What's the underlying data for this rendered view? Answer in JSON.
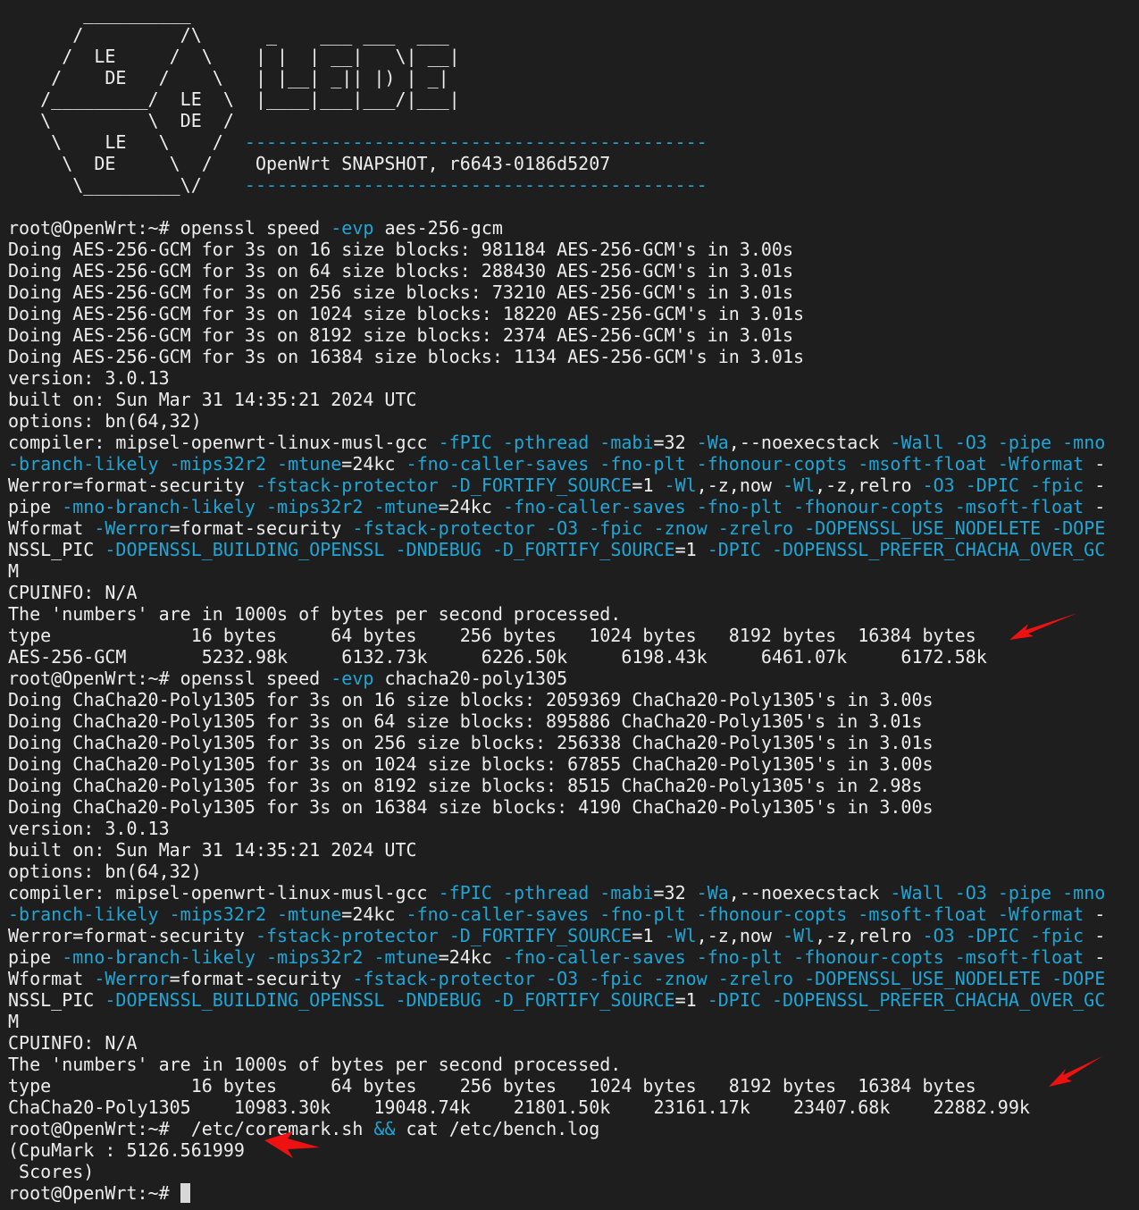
{
  "colors": {
    "background": "#1e1e1e",
    "text": "#ededed",
    "accent": "#1ea6d6",
    "arrow": "#ee1111"
  },
  "banner": [
    [
      [
        "       __________",
        ""
      ]
    ],
    [
      [
        "      /         /\\      _    ___ ___  ___",
        ""
      ]
    ],
    [
      [
        "     /  LE     /  \\    | |  | __|   \\| __|",
        ""
      ]
    ],
    [
      [
        "    /    DE   /    \\   | |__| _|| |) | _|",
        ""
      ]
    ],
    [
      [
        "   /_________/  LE  \\  |____|___|___/|___|",
        ""
      ]
    ],
    [
      [
        "   \\         \\  DE  /",
        ""
      ]
    ],
    [
      [
        "    \\    LE   \\    /  ",
        ""
      ],
      [
        "-------------------------------------------",
        "g"
      ]
    ],
    [
      [
        "     \\  DE     \\  /    OpenWrt SNAPSHOT, r6643-0186d5207",
        ""
      ]
    ],
    [
      [
        "      \\_________\\/    ",
        ""
      ],
      [
        "-------------------------------------------",
        "g"
      ]
    ],
    [
      [
        "",
        ""
      ]
    ]
  ],
  "session": [
    [
      [
        "root@OpenWrt:~# openssl speed ",
        ""
      ],
      [
        "-evp",
        "g"
      ],
      [
        " aes-256-gcm",
        ""
      ]
    ],
    [
      [
        "Doing AES-256-GCM for 3s on 16 size blocks: 981184 AES-256-GCM's in 3.00s",
        ""
      ]
    ],
    [
      [
        "Doing AES-256-GCM for 3s on 64 size blocks: 288430 AES-256-GCM's in 3.01s",
        ""
      ]
    ],
    [
      [
        "Doing AES-256-GCM for 3s on 256 size blocks: 73210 AES-256-GCM's in 3.01s",
        ""
      ]
    ],
    [
      [
        "Doing AES-256-GCM for 3s on 1024 size blocks: 18220 AES-256-GCM's in 3.01s",
        ""
      ]
    ],
    [
      [
        "Doing AES-256-GCM for 3s on 8192 size blocks: 2374 AES-256-GCM's in 3.01s",
        ""
      ]
    ],
    [
      [
        "Doing AES-256-GCM for 3s on 16384 size blocks: 1134 AES-256-GCM's in 3.01s",
        ""
      ]
    ],
    [
      [
        "version: 3.0.13",
        ""
      ]
    ],
    [
      [
        "built on: Sun Mar 31 14:35:21 2024 UTC",
        ""
      ]
    ],
    [
      [
        "options: bn(64,32)",
        ""
      ]
    ],
    [
      [
        "compiler: mipsel-openwrt-linux-musl-gcc ",
        ""
      ],
      [
        "-fPIC",
        "g"
      ],
      [
        " ",
        ""
      ],
      [
        "-pthread",
        "g"
      ],
      [
        " ",
        ""
      ],
      [
        "-mabi",
        "g"
      ],
      [
        "=32 ",
        ""
      ],
      [
        "-Wa",
        "g"
      ],
      [
        ",--noexecstack ",
        ""
      ],
      [
        "-Wall",
        "g"
      ],
      [
        " ",
        ""
      ],
      [
        "-O3",
        "g"
      ],
      [
        " ",
        ""
      ],
      [
        "-pipe",
        "g"
      ],
      [
        " ",
        ""
      ],
      [
        "-mno",
        "g"
      ]
    ],
    [
      [
        "-branch-likely",
        "g"
      ],
      [
        " ",
        ""
      ],
      [
        "-mips32r2",
        "g"
      ],
      [
        " ",
        ""
      ],
      [
        "-mtune",
        "g"
      ],
      [
        "=24kc ",
        ""
      ],
      [
        "-fno-caller-saves",
        "g"
      ],
      [
        " ",
        ""
      ],
      [
        "-fno-plt",
        "g"
      ],
      [
        " ",
        ""
      ],
      [
        "-fhonour-copts",
        "g"
      ],
      [
        " ",
        ""
      ],
      [
        "-msoft-float",
        "g"
      ],
      [
        " ",
        ""
      ],
      [
        "-Wformat",
        "g"
      ],
      [
        " -",
        ""
      ]
    ],
    [
      [
        "Werror=format-security ",
        ""
      ],
      [
        "-fstack-protector",
        "g"
      ],
      [
        " ",
        ""
      ],
      [
        "-D_FORTIFY_SOURCE",
        "g"
      ],
      [
        "=1 ",
        ""
      ],
      [
        "-Wl",
        "g"
      ],
      [
        ",-z,now ",
        ""
      ],
      [
        "-Wl",
        "g"
      ],
      [
        ",-z,relro ",
        ""
      ],
      [
        "-O3",
        "g"
      ],
      [
        " ",
        ""
      ],
      [
        "-DPIC",
        "g"
      ],
      [
        " ",
        ""
      ],
      [
        "-fpic",
        "g"
      ],
      [
        " -",
        ""
      ]
    ],
    [
      [
        "pipe ",
        ""
      ],
      [
        "-mno-branch-likely",
        "g"
      ],
      [
        " ",
        ""
      ],
      [
        "-mips32r2",
        "g"
      ],
      [
        " ",
        ""
      ],
      [
        "-mtune",
        "g"
      ],
      [
        "=24kc ",
        ""
      ],
      [
        "-fno-caller-saves",
        "g"
      ],
      [
        " ",
        ""
      ],
      [
        "-fno-plt",
        "g"
      ],
      [
        " ",
        ""
      ],
      [
        "-fhonour-copts",
        "g"
      ],
      [
        " ",
        ""
      ],
      [
        "-msoft-float",
        "g"
      ],
      [
        " -",
        ""
      ]
    ],
    [
      [
        "Wformat ",
        ""
      ],
      [
        "-Werror",
        "g"
      ],
      [
        "=format-security ",
        ""
      ],
      [
        "-fstack-protector",
        "g"
      ],
      [
        " ",
        ""
      ],
      [
        "-O3",
        "g"
      ],
      [
        " ",
        ""
      ],
      [
        "-fpic",
        "g"
      ],
      [
        " ",
        ""
      ],
      [
        "-znow",
        "g"
      ],
      [
        " ",
        ""
      ],
      [
        "-zrelro",
        "g"
      ],
      [
        " ",
        ""
      ],
      [
        "-DOPENSSL_USE_NODELETE",
        "g"
      ],
      [
        " ",
        ""
      ],
      [
        "-DOPE",
        "g"
      ]
    ],
    [
      [
        "NSSL_PIC ",
        ""
      ],
      [
        "-DOPENSSL_BUILDING_OPENSSL",
        "g"
      ],
      [
        " ",
        ""
      ],
      [
        "-DNDEBUG",
        "g"
      ],
      [
        " ",
        ""
      ],
      [
        "-D_FORTIFY_SOURCE",
        "g"
      ],
      [
        "=1 ",
        ""
      ],
      [
        "-DPIC",
        "g"
      ],
      [
        " ",
        ""
      ],
      [
        "-DOPENSSL_PREFER_CHACHA_OVER_GC",
        "g"
      ]
    ],
    [
      [
        "M",
        ""
      ]
    ],
    [
      [
        "CPUINFO: N/A",
        ""
      ]
    ],
    [
      [
        "The 'numbers' are in 1000s of bytes per second processed.",
        ""
      ]
    ],
    [
      [
        "type             16 bytes     64 bytes    256 bytes   1024 bytes   8192 bytes  16384 bytes",
        ""
      ]
    ],
    [
      [
        "AES-256-GCM       5232.98k     6132.73k     6226.50k     6198.43k     6461.07k     6172.58k",
        ""
      ]
    ],
    [
      [
        "root@OpenWrt:~# openssl speed ",
        ""
      ],
      [
        "-evp",
        "g"
      ],
      [
        " chacha20-poly1305",
        ""
      ]
    ],
    [
      [
        "Doing ChaCha20-Poly1305 for 3s on 16 size blocks: 2059369 ChaCha20-Poly1305's in 3.00s",
        ""
      ]
    ],
    [
      [
        "Doing ChaCha20-Poly1305 for 3s on 64 size blocks: 895886 ChaCha20-Poly1305's in 3.01s",
        ""
      ]
    ],
    [
      [
        "Doing ChaCha20-Poly1305 for 3s on 256 size blocks: 256338 ChaCha20-Poly1305's in 3.01s",
        ""
      ]
    ],
    [
      [
        "Doing ChaCha20-Poly1305 for 3s on 1024 size blocks: 67855 ChaCha20-Poly1305's in 3.00s",
        ""
      ]
    ],
    [
      [
        "Doing ChaCha20-Poly1305 for 3s on 8192 size blocks: 8515 ChaCha20-Poly1305's in 2.98s",
        ""
      ]
    ],
    [
      [
        "Doing ChaCha20-Poly1305 for 3s on 16384 size blocks: 4190 ChaCha20-Poly1305's in 3.00s",
        ""
      ]
    ],
    [
      [
        "version: 3.0.13",
        ""
      ]
    ],
    [
      [
        "built on: Sun Mar 31 14:35:21 2024 UTC",
        ""
      ]
    ],
    [
      [
        "options: bn(64,32)",
        ""
      ]
    ],
    [
      [
        "compiler: mipsel-openwrt-linux-musl-gcc ",
        ""
      ],
      [
        "-fPIC",
        "g"
      ],
      [
        " ",
        ""
      ],
      [
        "-pthread",
        "g"
      ],
      [
        " ",
        ""
      ],
      [
        "-mabi",
        "g"
      ],
      [
        "=32 ",
        ""
      ],
      [
        "-Wa",
        "g"
      ],
      [
        ",--noexecstack ",
        ""
      ],
      [
        "-Wall",
        "g"
      ],
      [
        " ",
        ""
      ],
      [
        "-O3",
        "g"
      ],
      [
        " ",
        ""
      ],
      [
        "-pipe",
        "g"
      ],
      [
        " ",
        ""
      ],
      [
        "-mno",
        "g"
      ]
    ],
    [
      [
        "-branch-likely",
        "g"
      ],
      [
        " ",
        ""
      ],
      [
        "-mips32r2",
        "g"
      ],
      [
        " ",
        ""
      ],
      [
        "-mtune",
        "g"
      ],
      [
        "=24kc ",
        ""
      ],
      [
        "-fno-caller-saves",
        "g"
      ],
      [
        " ",
        ""
      ],
      [
        "-fno-plt",
        "g"
      ],
      [
        " ",
        ""
      ],
      [
        "-fhonour-copts",
        "g"
      ],
      [
        " ",
        ""
      ],
      [
        "-msoft-float",
        "g"
      ],
      [
        " ",
        ""
      ],
      [
        "-Wformat",
        "g"
      ],
      [
        " -",
        ""
      ]
    ],
    [
      [
        "Werror=format-security ",
        ""
      ],
      [
        "-fstack-protector",
        "g"
      ],
      [
        " ",
        ""
      ],
      [
        "-D_FORTIFY_SOURCE",
        "g"
      ],
      [
        "=1 ",
        ""
      ],
      [
        "-Wl",
        "g"
      ],
      [
        ",-z,now ",
        ""
      ],
      [
        "-Wl",
        "g"
      ],
      [
        ",-z,relro ",
        ""
      ],
      [
        "-O3",
        "g"
      ],
      [
        " ",
        ""
      ],
      [
        "-DPIC",
        "g"
      ],
      [
        " ",
        ""
      ],
      [
        "-fpic",
        "g"
      ],
      [
        " -",
        ""
      ]
    ],
    [
      [
        "pipe ",
        ""
      ],
      [
        "-mno-branch-likely",
        "g"
      ],
      [
        " ",
        ""
      ],
      [
        "-mips32r2",
        "g"
      ],
      [
        " ",
        ""
      ],
      [
        "-mtune",
        "g"
      ],
      [
        "=24kc ",
        ""
      ],
      [
        "-fno-caller-saves",
        "g"
      ],
      [
        " ",
        ""
      ],
      [
        "-fno-plt",
        "g"
      ],
      [
        " ",
        ""
      ],
      [
        "-fhonour-copts",
        "g"
      ],
      [
        " ",
        ""
      ],
      [
        "-msoft-float",
        "g"
      ],
      [
        " -",
        ""
      ]
    ],
    [
      [
        "Wformat ",
        ""
      ],
      [
        "-Werror",
        "g"
      ],
      [
        "=format-security ",
        ""
      ],
      [
        "-fstack-protector",
        "g"
      ],
      [
        " ",
        ""
      ],
      [
        "-O3",
        "g"
      ],
      [
        " ",
        ""
      ],
      [
        "-fpic",
        "g"
      ],
      [
        " ",
        ""
      ],
      [
        "-znow",
        "g"
      ],
      [
        " ",
        ""
      ],
      [
        "-zrelro",
        "g"
      ],
      [
        " ",
        ""
      ],
      [
        "-DOPENSSL_USE_NODELETE",
        "g"
      ],
      [
        " ",
        ""
      ],
      [
        "-DOPE",
        "g"
      ]
    ],
    [
      [
        "NSSL_PIC ",
        ""
      ],
      [
        "-DOPENSSL_BUILDING_OPENSSL",
        "g"
      ],
      [
        " ",
        ""
      ],
      [
        "-DNDEBUG",
        "g"
      ],
      [
        " ",
        ""
      ],
      [
        "-D_FORTIFY_SOURCE",
        "g"
      ],
      [
        "=1 ",
        ""
      ],
      [
        "-DPIC",
        "g"
      ],
      [
        " ",
        ""
      ],
      [
        "-DOPENSSL_PREFER_CHACHA_OVER_GC",
        "g"
      ]
    ],
    [
      [
        "M",
        ""
      ]
    ],
    [
      [
        "CPUINFO: N/A",
        ""
      ]
    ],
    [
      [
        "The 'numbers' are in 1000s of bytes per second processed.",
        ""
      ]
    ],
    [
      [
        "type             16 bytes     64 bytes    256 bytes   1024 bytes   8192 bytes  16384 bytes",
        ""
      ]
    ],
    [
      [
        "ChaCha20-Poly1305    10983.30k    19048.74k    21801.50k    23161.17k    23407.68k    22882.99k",
        ""
      ]
    ],
    [
      [
        "root@OpenWrt:~#  /etc/coremark.sh ",
        ""
      ],
      [
        "&&",
        "g"
      ],
      [
        " cat /etc/bench.log",
        ""
      ]
    ],
    [
      [
        "(CpuMark : 5126.561999",
        ""
      ]
    ],
    [
      [
        " Scores)",
        ""
      ]
    ]
  ],
  "prompt": "root@OpenWrt:~# "
}
